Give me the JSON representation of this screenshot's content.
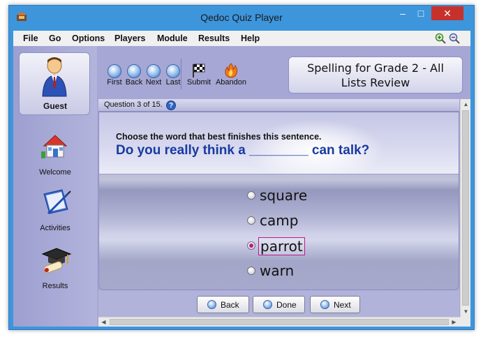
{
  "window": {
    "title": "Qedoc Quiz Player"
  },
  "menu": [
    "File",
    "Go",
    "Options",
    "Players",
    "Module",
    "Results",
    "Help"
  ],
  "user": {
    "name": "Guest"
  },
  "sidebar": {
    "items": [
      {
        "label": "Welcome"
      },
      {
        "label": "Activities"
      },
      {
        "label": "Results"
      }
    ]
  },
  "toolbar": {
    "nav": [
      {
        "label": "First"
      },
      {
        "label": "Back"
      },
      {
        "label": "Next"
      },
      {
        "label": "Last"
      }
    ],
    "submit": "Submit",
    "abandon": "Abandon"
  },
  "module": {
    "title_line1": "Spelling for Grade 2 - All",
    "title_line2": "Lists Review"
  },
  "question": {
    "counter": "Question 3 of 15.",
    "instruction": "Choose the word that best finishes this sentence.",
    "text": "Do you really think a ________ can talk?",
    "answers": [
      {
        "label": "square",
        "selected": false
      },
      {
        "label": "camp",
        "selected": false
      },
      {
        "label": "parrot",
        "selected": true
      },
      {
        "label": "warn",
        "selected": false
      }
    ]
  },
  "bottom": {
    "back": "Back",
    "done": "Done",
    "next": "Next"
  },
  "colors": {
    "accent": "#3d95dc",
    "question_text": "#1a3aa0",
    "selected": "#c0178a",
    "panel": "#a6a7d4"
  }
}
